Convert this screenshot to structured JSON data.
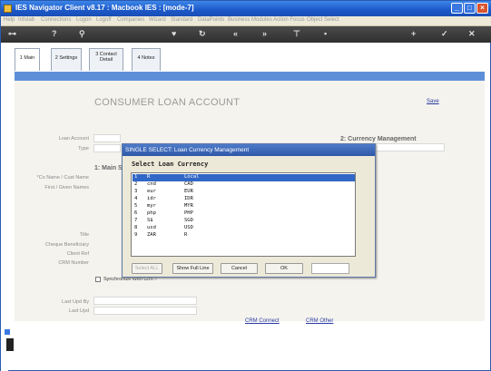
{
  "window": {
    "title": "IES Navigator Client v8.17 : Macbook IES :     [mode-7]"
  },
  "menu": [
    {
      "label": "Help",
      "on": true
    },
    {
      "label": "Infolab",
      "on": true
    },
    {
      "label": "Connections",
      "on": false
    },
    {
      "label": "Logon",
      "on": false
    },
    {
      "label": "Logoff",
      "on": true
    },
    {
      "label": "Companies",
      "on": false
    },
    {
      "label": "Wizard",
      "on": false
    },
    {
      "label": "Standard",
      "on": false
    },
    {
      "label": "DataPoints",
      "on": false
    },
    {
      "label": "Business Modules",
      "on": false
    },
    {
      "label": "Action Focus",
      "on": false
    },
    {
      "label": "Object Select",
      "on": false
    }
  ],
  "tabs": [
    {
      "label": "1 Main",
      "active": true
    },
    {
      "label": "2 Settings",
      "active": false
    },
    {
      "label": "3 Contact Detail",
      "active": false
    },
    {
      "label": "4 Notes",
      "active": false
    }
  ],
  "form": {
    "heading": "CONSUMER LOAN ACCOUNT",
    "save_link": "Save",
    "section1": "1: Main S",
    "section2": "2: Currency Management",
    "labels": {
      "loan_account": "Loan Account",
      "type": "Type",
      "co_name": "*Co Name / Cust Name",
      "first_names": "First / Given Names",
      "title": "Title",
      "cheque_beneficiary": "Cheque Beneficiary",
      "client_ref": "Client Ref",
      "crm_number": "CRM Number",
      "last_upd_by": "Last Upd By",
      "last_upd": "Last Upd"
    },
    "sync_label": "Synchronize With Crm ?",
    "crm_connect": "CRM Connect",
    "crm_other": "CRM Other"
  },
  "dialog": {
    "title": "SINGLE SELECT: Loan Currency Management",
    "header": "Select Loan Currency",
    "rows": [
      {
        "num": "1",
        "code": "R",
        "desc": "Local"
      },
      {
        "num": "2",
        "code": "cnd",
        "desc": "CAD"
      },
      {
        "num": "3",
        "code": "eur",
        "desc": "EUR"
      },
      {
        "num": "4",
        "code": "idr",
        "desc": "IDR"
      },
      {
        "num": "5",
        "code": "myr",
        "desc": "MYR"
      },
      {
        "num": "6",
        "code": "php",
        "desc": "PHP"
      },
      {
        "num": "7",
        "code": "S$",
        "desc": "SGD"
      },
      {
        "num": "8",
        "code": "usd",
        "desc": "USD"
      },
      {
        "num": "9",
        "code": "ZAR",
        "desc": "R"
      }
    ],
    "selected_index": 0,
    "buttons": {
      "select_all": "Select ALL",
      "show_full_line": "Show Full Line",
      "cancel": "Cancel",
      "ok": "OK"
    }
  },
  "colors": {
    "accent": "#3167c6",
    "title_bar": "#1c58c9",
    "band": "#5d8fd8"
  }
}
